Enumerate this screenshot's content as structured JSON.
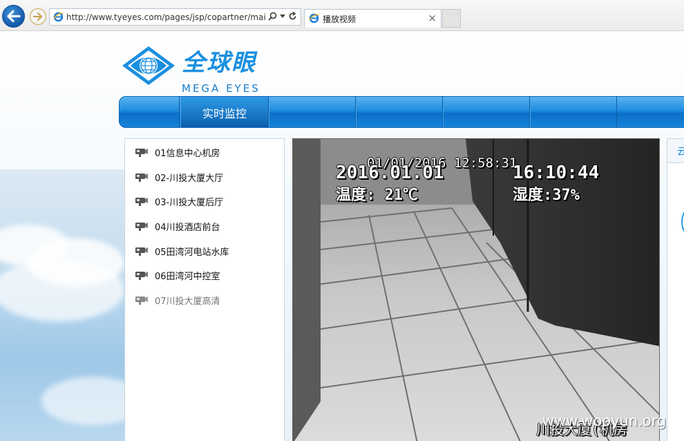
{
  "browser": {
    "url": "http://www.tyeyes.com/pages/jsp/copartner/mair",
    "tab_title": "播放视频",
    "tab_close": "×"
  },
  "logo": {
    "name_cn": "全球眼",
    "name_en": "MEGA   EYES"
  },
  "nav": {
    "items": [
      {
        "label": "实时监控",
        "active": true
      },
      {
        "label": ""
      },
      {
        "label": ""
      },
      {
        "label": ""
      },
      {
        "label": ""
      }
    ]
  },
  "cameras": [
    {
      "label": "01信息中心机房"
    },
    {
      "label": "02-川投大厦大厅"
    },
    {
      "label": "03-川投大厦后厅"
    },
    {
      "label": "04川投酒店前台"
    },
    {
      "label": "05田湾河电站水库"
    },
    {
      "label": "06田湾河中控室"
    },
    {
      "label": "07川投大厦高清"
    }
  ],
  "video": {
    "osd_top": "01/01/2016 12:58:31",
    "osd_date": "2016.01.01",
    "osd_time": "16:10:44",
    "osd_temp": "温度: 21℃",
    "osd_humidity": "湿度:37%",
    "bottom_caption": "川投大厦(机房"
  },
  "right_panel": {
    "tab_label": "云"
  },
  "watermark": "www.wooyun.org"
}
